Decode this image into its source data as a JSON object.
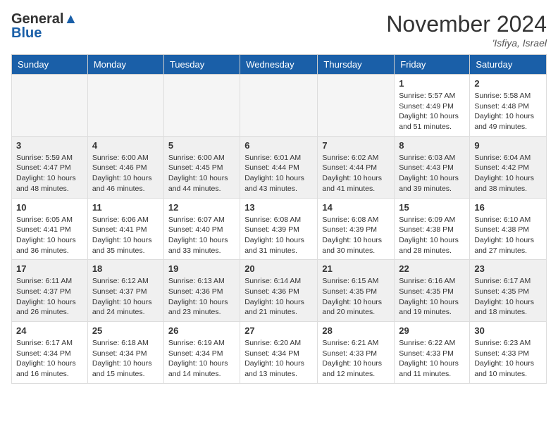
{
  "header": {
    "logo_line1": "General",
    "logo_line2": "Blue",
    "month": "November 2024",
    "location": "'Isfiya, Israel"
  },
  "weekdays": [
    "Sunday",
    "Monday",
    "Tuesday",
    "Wednesday",
    "Thursday",
    "Friday",
    "Saturday"
  ],
  "weeks": [
    [
      {
        "day": "",
        "info": ""
      },
      {
        "day": "",
        "info": ""
      },
      {
        "day": "",
        "info": ""
      },
      {
        "day": "",
        "info": ""
      },
      {
        "day": "",
        "info": ""
      },
      {
        "day": "1",
        "info": "Sunrise: 5:57 AM\nSunset: 4:49 PM\nDaylight: 10 hours and 51 minutes."
      },
      {
        "day": "2",
        "info": "Sunrise: 5:58 AM\nSunset: 4:48 PM\nDaylight: 10 hours and 49 minutes."
      }
    ],
    [
      {
        "day": "3",
        "info": "Sunrise: 5:59 AM\nSunset: 4:47 PM\nDaylight: 10 hours and 48 minutes."
      },
      {
        "day": "4",
        "info": "Sunrise: 6:00 AM\nSunset: 4:46 PM\nDaylight: 10 hours and 46 minutes."
      },
      {
        "day": "5",
        "info": "Sunrise: 6:00 AM\nSunset: 4:45 PM\nDaylight: 10 hours and 44 minutes."
      },
      {
        "day": "6",
        "info": "Sunrise: 6:01 AM\nSunset: 4:44 PM\nDaylight: 10 hours and 43 minutes."
      },
      {
        "day": "7",
        "info": "Sunrise: 6:02 AM\nSunset: 4:44 PM\nDaylight: 10 hours and 41 minutes."
      },
      {
        "day": "8",
        "info": "Sunrise: 6:03 AM\nSunset: 4:43 PM\nDaylight: 10 hours and 39 minutes."
      },
      {
        "day": "9",
        "info": "Sunrise: 6:04 AM\nSunset: 4:42 PM\nDaylight: 10 hours and 38 minutes."
      }
    ],
    [
      {
        "day": "10",
        "info": "Sunrise: 6:05 AM\nSunset: 4:41 PM\nDaylight: 10 hours and 36 minutes."
      },
      {
        "day": "11",
        "info": "Sunrise: 6:06 AM\nSunset: 4:41 PM\nDaylight: 10 hours and 35 minutes."
      },
      {
        "day": "12",
        "info": "Sunrise: 6:07 AM\nSunset: 4:40 PM\nDaylight: 10 hours and 33 minutes."
      },
      {
        "day": "13",
        "info": "Sunrise: 6:08 AM\nSunset: 4:39 PM\nDaylight: 10 hours and 31 minutes."
      },
      {
        "day": "14",
        "info": "Sunrise: 6:08 AM\nSunset: 4:39 PM\nDaylight: 10 hours and 30 minutes."
      },
      {
        "day": "15",
        "info": "Sunrise: 6:09 AM\nSunset: 4:38 PM\nDaylight: 10 hours and 28 minutes."
      },
      {
        "day": "16",
        "info": "Sunrise: 6:10 AM\nSunset: 4:38 PM\nDaylight: 10 hours and 27 minutes."
      }
    ],
    [
      {
        "day": "17",
        "info": "Sunrise: 6:11 AM\nSunset: 4:37 PM\nDaylight: 10 hours and 26 minutes."
      },
      {
        "day": "18",
        "info": "Sunrise: 6:12 AM\nSunset: 4:37 PM\nDaylight: 10 hours and 24 minutes."
      },
      {
        "day": "19",
        "info": "Sunrise: 6:13 AM\nSunset: 4:36 PM\nDaylight: 10 hours and 23 minutes."
      },
      {
        "day": "20",
        "info": "Sunrise: 6:14 AM\nSunset: 4:36 PM\nDaylight: 10 hours and 21 minutes."
      },
      {
        "day": "21",
        "info": "Sunrise: 6:15 AM\nSunset: 4:35 PM\nDaylight: 10 hours and 20 minutes."
      },
      {
        "day": "22",
        "info": "Sunrise: 6:16 AM\nSunset: 4:35 PM\nDaylight: 10 hours and 19 minutes."
      },
      {
        "day": "23",
        "info": "Sunrise: 6:17 AM\nSunset: 4:35 PM\nDaylight: 10 hours and 18 minutes."
      }
    ],
    [
      {
        "day": "24",
        "info": "Sunrise: 6:17 AM\nSunset: 4:34 PM\nDaylight: 10 hours and 16 minutes."
      },
      {
        "day": "25",
        "info": "Sunrise: 6:18 AM\nSunset: 4:34 PM\nDaylight: 10 hours and 15 minutes."
      },
      {
        "day": "26",
        "info": "Sunrise: 6:19 AM\nSunset: 4:34 PM\nDaylight: 10 hours and 14 minutes."
      },
      {
        "day": "27",
        "info": "Sunrise: 6:20 AM\nSunset: 4:34 PM\nDaylight: 10 hours and 13 minutes."
      },
      {
        "day": "28",
        "info": "Sunrise: 6:21 AM\nSunset: 4:33 PM\nDaylight: 10 hours and 12 minutes."
      },
      {
        "day": "29",
        "info": "Sunrise: 6:22 AM\nSunset: 4:33 PM\nDaylight: 10 hours and 11 minutes."
      },
      {
        "day": "30",
        "info": "Sunrise: 6:23 AM\nSunset: 4:33 PM\nDaylight: 10 hours and 10 minutes."
      }
    ]
  ]
}
